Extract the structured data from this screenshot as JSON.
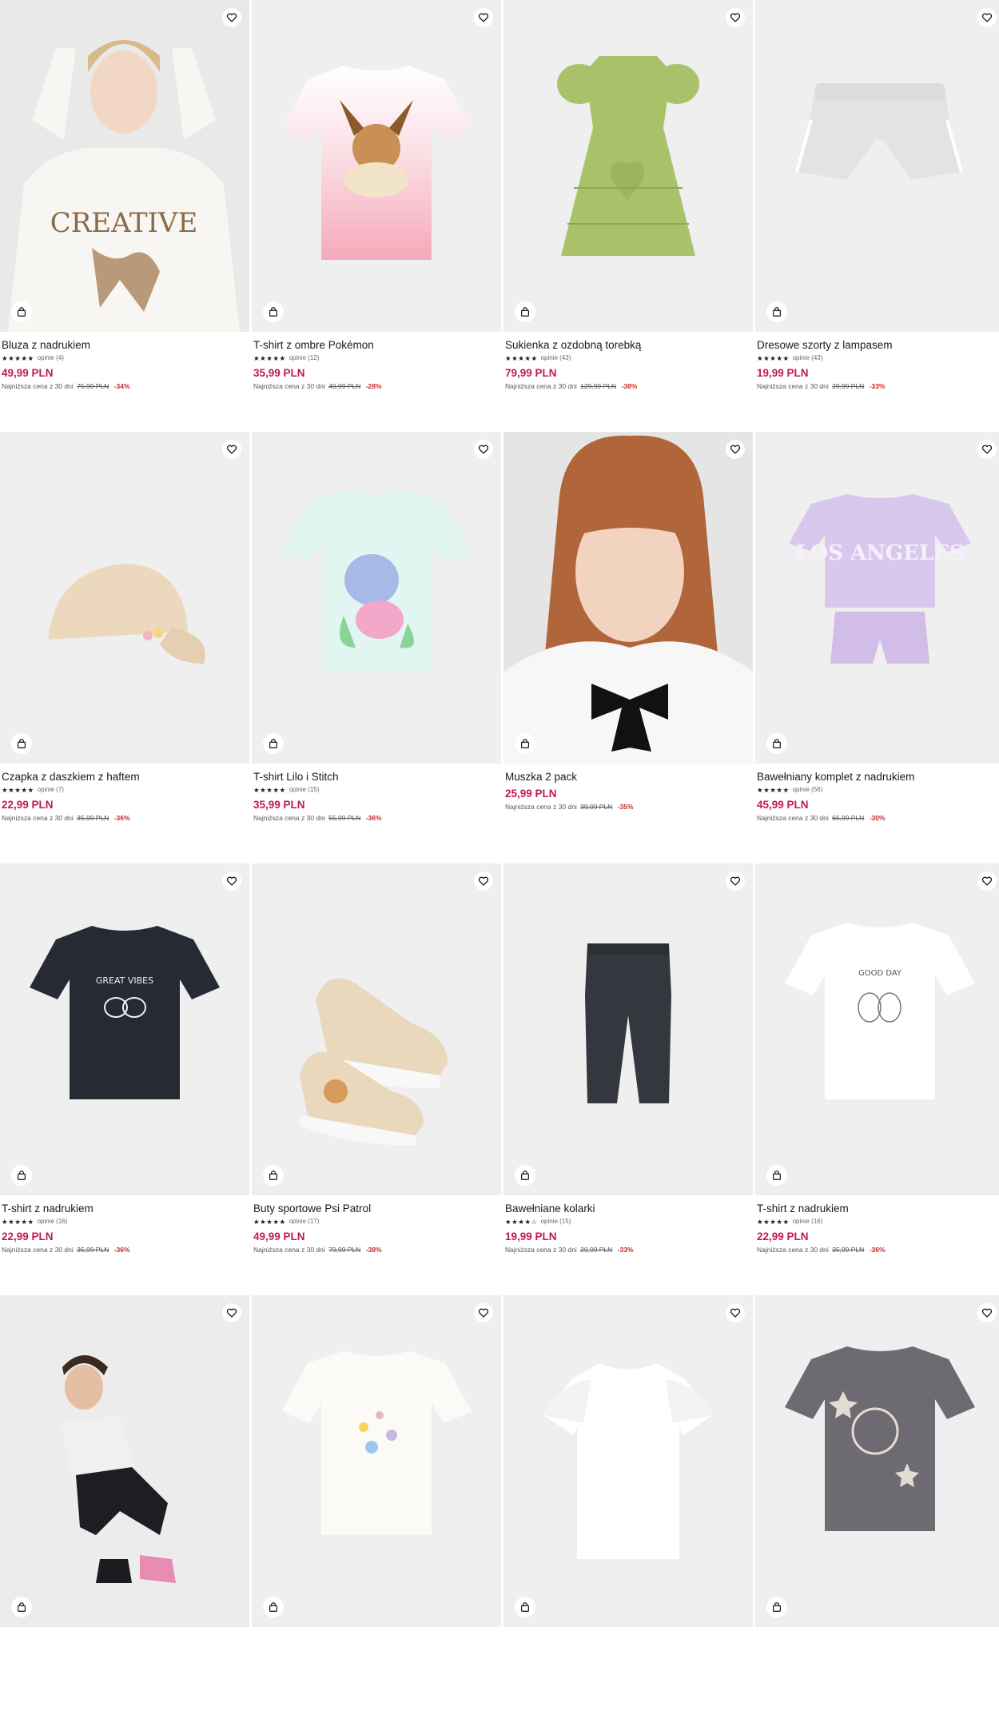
{
  "colors": {
    "price": "#c2185b",
    "discount": "#c62828",
    "image_bg": "#efeff0"
  },
  "icons": {
    "favorite": "heart-icon",
    "cart": "shopping-bag-icon"
  },
  "lowest_price_label": "Najniższa cena z 30 dni",
  "products": [
    {
      "name": "Bluza z nadrukiem",
      "stars": "★★★★★",
      "reviews": "opinie (4)",
      "price": "49,99 PLN",
      "old_price": "75,99 PLN",
      "discount": "-34%"
    },
    {
      "name": "T-shirt z ombre Pokémon",
      "stars": "★★★★★",
      "reviews": "opinie (12)",
      "price": "35,99 PLN",
      "old_price": "49,99 PLN",
      "discount": "-28%"
    },
    {
      "name": "Sukienka z ozdobną torebką",
      "stars": "★★★★★",
      "reviews": "opinie (43)",
      "price": "79,99 PLN",
      "old_price": "129,99 PLN",
      "discount": "-38%"
    },
    {
      "name": "Dresowe szorty z lampasem",
      "stars": "★★★★★",
      "reviews": "opinie (43)",
      "price": "19,99 PLN",
      "old_price": "29,99 PLN",
      "discount": "-33%"
    },
    {
      "name": "Czapka z daszkiem z haftem",
      "stars": "★★★★★",
      "reviews": "opinie (7)",
      "price": "22,99 PLN",
      "old_price": "35,99 PLN",
      "discount": "-36%"
    },
    {
      "name": "T-shirt Lilo i Stitch",
      "stars": "★★★★★",
      "reviews": "opinie (15)",
      "price": "35,99 PLN",
      "old_price": "55,99 PLN",
      "discount": "-36%"
    },
    {
      "name": "Muszka 2 pack",
      "stars": "",
      "reviews": "",
      "price": "25,99 PLN",
      "old_price": "39,99 PLN",
      "discount": "-35%"
    },
    {
      "name": "Bawełniany komplet z nadrukiem",
      "stars": "★★★★★",
      "reviews": "opinie (56)",
      "price": "45,99 PLN",
      "old_price": "65,99 PLN",
      "discount": "-30%"
    },
    {
      "name": "T-shirt z nadrukiem",
      "stars": "★★★★★",
      "reviews": "opinie (16)",
      "price": "22,99 PLN",
      "old_price": "35,99 PLN",
      "discount": "-36%"
    },
    {
      "name": "Buty sportowe Psi Patrol",
      "stars": "★★★★★",
      "reviews": "opinie (17)",
      "price": "49,99 PLN",
      "old_price": "79,99 PLN",
      "discount": "-38%"
    },
    {
      "name": "Bawełniane kolarki",
      "stars": "★★★★☆",
      "reviews": "opinie (15)",
      "price": "19,99 PLN",
      "old_price": "29,99 PLN",
      "discount": "-33%"
    },
    {
      "name": "T-shirt z nadrukiem",
      "stars": "★★★★★",
      "reviews": "opinie (16)",
      "price": "22,99 PLN",
      "old_price": "35,99 PLN",
      "discount": "-36%"
    },
    {
      "name": "",
      "stars": "",
      "reviews": "",
      "price": "",
      "old_price": "",
      "discount": ""
    },
    {
      "name": "",
      "stars": "",
      "reviews": "",
      "price": "",
      "old_price": "",
      "discount": ""
    },
    {
      "name": "",
      "stars": "",
      "reviews": "",
      "price": "",
      "old_price": "",
      "discount": ""
    },
    {
      "name": "",
      "stars": "",
      "reviews": "",
      "price": "",
      "old_price": "",
      "discount": ""
    }
  ],
  "image_art": [
    "sweatshirt-girl",
    "pink-tshirt",
    "green-dress",
    "grey-shorts",
    "cap",
    "mint-tshirt",
    "bow-girl",
    "lilac-set",
    "navy-tshirt",
    "sneakers",
    "bike-shorts",
    "white-tshirt",
    "girl-crouching",
    "cream-tshirt",
    "white-blouse",
    "grey-tshirt"
  ]
}
